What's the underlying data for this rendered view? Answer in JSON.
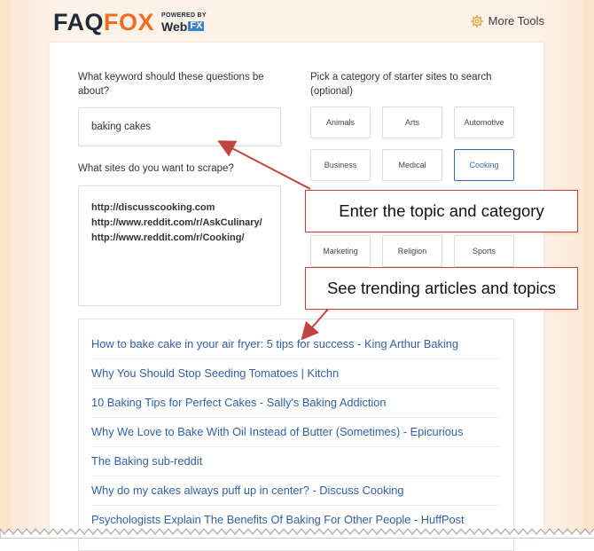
{
  "header": {
    "logo_faq": "FAQ",
    "logo_fox": "FOX",
    "powered_by": "POWERED BY",
    "webfx_web": "Web",
    "webfx_fx": "FX",
    "more_tools": "More Tools"
  },
  "form": {
    "keyword_label": "What keyword should these questions be about?",
    "keyword_value": "baking cakes",
    "sites_label": "What sites do you want to scrape?",
    "sites": [
      "http://discusscooking.com",
      "http://www.reddit.com/r/AskCulinary/",
      "http://www.reddit.com/r/Cooking/"
    ],
    "category_label": "Pick a category of starter sites to search (optional)",
    "categories": [
      {
        "label": "Animals",
        "selected": false
      },
      {
        "label": "Arts",
        "selected": false
      },
      {
        "label": "Automotive",
        "selected": false
      },
      {
        "label": "Business",
        "selected": false
      },
      {
        "label": "Medical",
        "selected": false
      },
      {
        "label": "Cooking",
        "selected": true
      },
      {
        "label": "Marketing",
        "selected": false
      },
      {
        "label": "Religion",
        "selected": false
      },
      {
        "label": "Sports",
        "selected": false
      }
    ]
  },
  "callouts": {
    "topic": "Enter the topic and category",
    "trending": "See trending articles and topics"
  },
  "articles": [
    "How to bake cake in your air fryer: 5 tips for success - King Arthur Baking",
    "Why You Should Stop Seeding Tomatoes | Kitchn",
    "10 Baking Tips for Perfect Cakes - Sally's Baking Addiction",
    "Why We Love to Bake With Oil Instead of Butter (Sometimes) - Epicurious",
    "The Baking sub-reddit",
    "Why do my cakes always puff up in center? - Discuss Cooking",
    "Psychologists Explain The Benefits Of Baking For Other People - HuffPost"
  ],
  "colors": {
    "accent_orange": "#f26c22",
    "link_blue": "#3160a8",
    "selected_border": "#3b6aa8",
    "annotation_red": "#c0453e"
  }
}
